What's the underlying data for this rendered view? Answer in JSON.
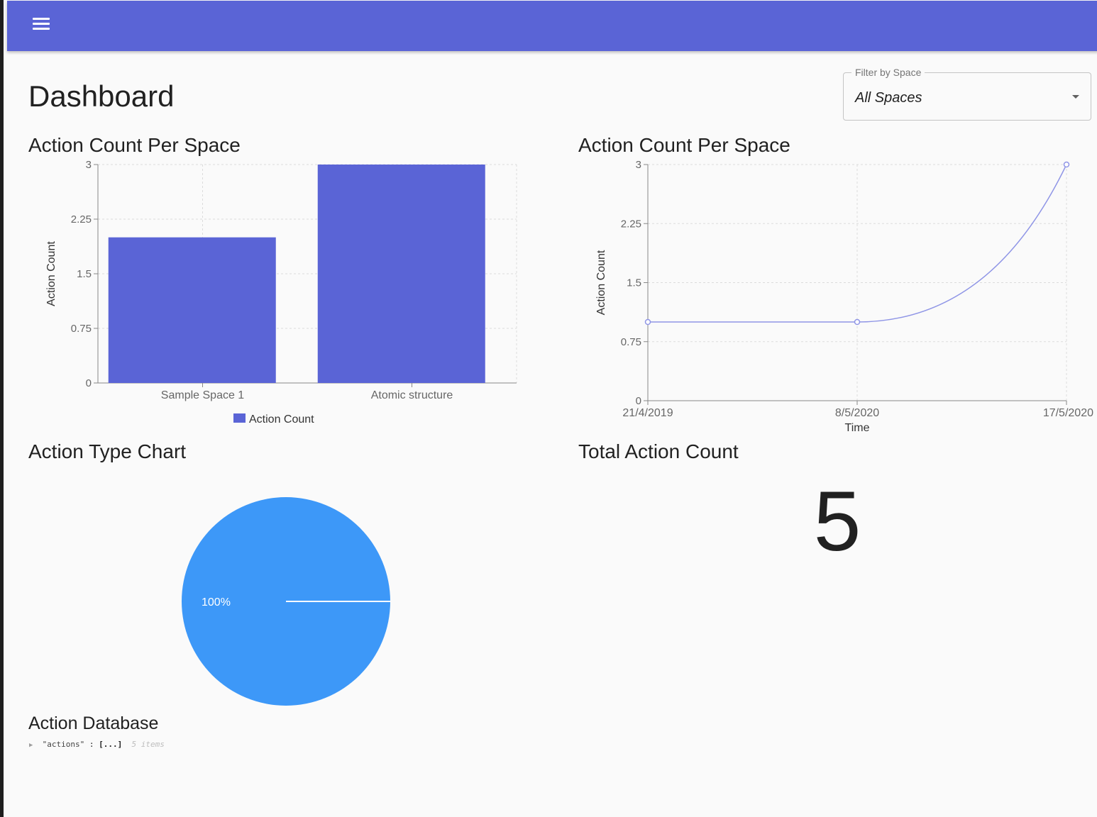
{
  "app": {
    "title": "Dashboard",
    "menu_icon": "hamburger-menu-icon",
    "accent_color": "#5a64d6"
  },
  "filter": {
    "label": "Filter by Space",
    "value": "All Spaces"
  },
  "charts": {
    "bar_title": "Action Count Per Space",
    "line_title": "Action Count Per Space",
    "pie_title": "Action Type Chart",
    "total_title": "Total Action Count"
  },
  "chart_data": [
    {
      "type": "bar",
      "title": "Action Count Per Space",
      "categories": [
        "Sample Space 1",
        "Atomic structure"
      ],
      "series": [
        {
          "name": "Action Count",
          "values": [
            2,
            3
          ],
          "color": "#5a64d6"
        }
      ],
      "ylabel": "Action Count",
      "xlabel": "",
      "ylim": [
        0,
        3
      ],
      "yticks": [
        "0",
        "0.75",
        "1.5",
        "2.25",
        "3"
      ],
      "grid": true,
      "legend": "bottom"
    },
    {
      "type": "line",
      "title": "Action Count Per Space",
      "x": [
        "21/4/2019",
        "8/5/2020",
        "17/5/2020"
      ],
      "series": [
        {
          "values": [
            1,
            1,
            3
          ],
          "color": "#8f95e6"
        }
      ],
      "ylabel": "Action Count",
      "xlabel": "Time",
      "ylim": [
        0,
        3
      ],
      "yticks": [
        "0",
        "0.75",
        "1.5",
        "2.25",
        "3"
      ],
      "grid": true
    },
    {
      "type": "pie",
      "title": "Action Type Chart",
      "slices": [
        {
          "value": 100,
          "label": "100%",
          "color": "#3d98f8"
        }
      ]
    }
  ],
  "total": {
    "value": "5"
  },
  "database": {
    "title": "Action Database",
    "key": "\"actions\"",
    "collapsed": "[...]",
    "count": "5 items"
  }
}
